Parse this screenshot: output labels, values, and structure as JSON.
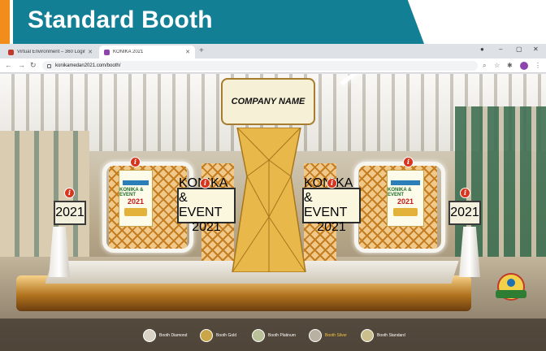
{
  "slide": {
    "title": "Standard Booth",
    "accent_color": "#f28c1a",
    "band_color": "#137f95"
  },
  "browser": {
    "tabs": [
      {
        "label": "Virtual Environment – 360 Login",
        "active": false
      },
      {
        "label": "KONIKA 2021",
        "active": true
      }
    ],
    "url": "konikamedan2021.com/booth/"
  },
  "booth": {
    "company_name": "COMPANY NAME",
    "poster": {
      "title": "KONIKA & EVENT",
      "year": "2021"
    },
    "info_icon": "i"
  },
  "booth_nav": {
    "items": [
      {
        "label": "Booth Diamond",
        "color": "#d8d3c4",
        "active": false
      },
      {
        "label": "Booth Gold",
        "color": "#c9a648",
        "active": false
      },
      {
        "label": "Booth Platinum",
        "color": "#b9c09a",
        "active": false
      },
      {
        "label": "Booth Silver",
        "color": "#b8b0a0",
        "active": true
      },
      {
        "label": "Booth Standard",
        "color": "#cbbf8e",
        "active": false
      }
    ]
  },
  "icons": [
    "back-icon",
    "forward-icon",
    "reload-icon",
    "lock-icon",
    "search-icon",
    "star-icon",
    "extension-icon",
    "profile-icon",
    "menu-icon",
    "info-icon"
  ]
}
